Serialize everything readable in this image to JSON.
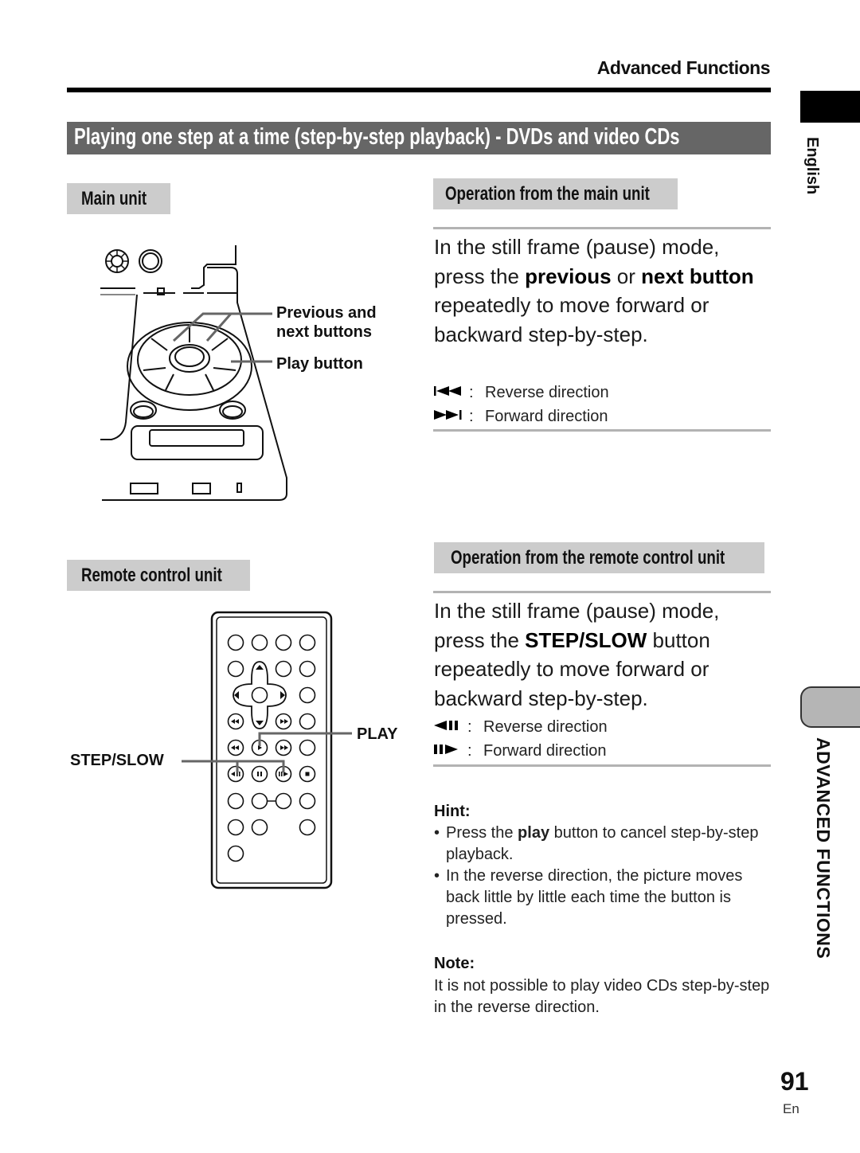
{
  "header": {
    "section": "Advanced Functions"
  },
  "title": "Playing one step at a time (step-by-step playback) - DVDs and video CDs",
  "side_tabs": {
    "language": "English",
    "chapter": "ADVANCED FUNCTIONS"
  },
  "main_unit": {
    "label": "Main unit",
    "callouts": {
      "prev_next": [
        "Previous and",
        "next buttons"
      ],
      "play": "Play button"
    }
  },
  "main_unit_operation": {
    "heading": "Operation from the main unit",
    "instruction": {
      "part1": "In the still frame (pause) mode, press the ",
      "bold1": "previous",
      "part2": " or ",
      "bold2": "next",
      "part3": " ",
      "bold3": "button",
      "part4": " repeatedly to move forward or backward step-by-step."
    },
    "directions": [
      {
        "icon": "previous-track-icon",
        "symbol": "⏮",
        "separator": ":",
        "text": "Reverse direction"
      },
      {
        "icon": "next-track-icon",
        "symbol": "⏭",
        "separator": ":",
        "text": "Forward direction"
      }
    ]
  },
  "remote_unit": {
    "label": "Remote control unit",
    "callouts": {
      "play": "PLAY",
      "step_slow": "STEP/SLOW"
    }
  },
  "remote_operation": {
    "heading": "Operation from the remote control unit",
    "instruction": {
      "part1": "In the still frame (pause) mode, press the ",
      "bold1": "STEP/SLOW",
      "part2": " button repeatedly to move forward or backward step-by-step."
    },
    "directions": [
      {
        "icon": "step-reverse-icon",
        "symbol": "◀❚❚",
        "separator": ":",
        "text": "Reverse direction"
      },
      {
        "icon": "step-forward-icon",
        "symbol": "❚❚▶",
        "separator": ":",
        "text": "Forward direction"
      }
    ]
  },
  "hint": {
    "title": "Hint:",
    "items": [
      {
        "pre": "Press the ",
        "bold": "play",
        "post": " button to cancel step-by-step playback."
      },
      {
        "pre": "In the reverse direction, the picture moves back little by little each time the button is pressed.",
        "bold": "",
        "post": ""
      }
    ]
  },
  "note": {
    "title": "Note:",
    "text": "It is not possible to play video CDs step-by-step in the reverse direction."
  },
  "footer": {
    "page_number": "91",
    "language_code": "En"
  }
}
